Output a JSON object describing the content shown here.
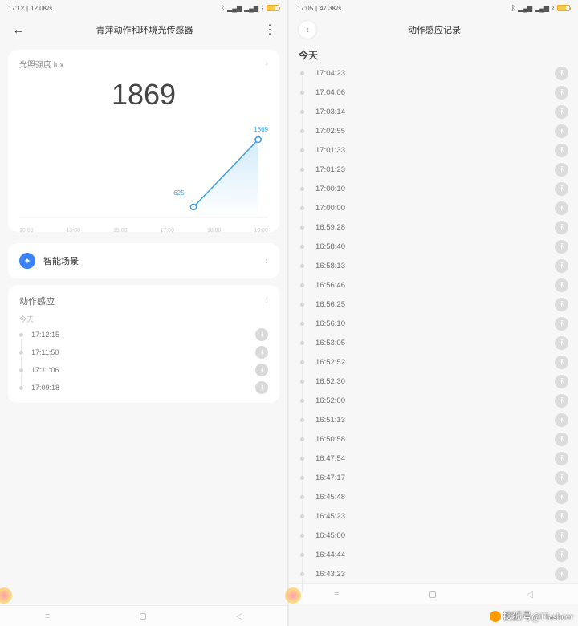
{
  "left": {
    "status": {
      "time": "17:12",
      "speed": "12.0K/s"
    },
    "title": "青萍动作和环境光传感器",
    "lux": {
      "label": "光照强度 lux",
      "value": "1869"
    },
    "chart_data": {
      "type": "line",
      "x": [
        "10:00",
        "13:00",
        "15:00",
        "17:00",
        "18:00",
        "19:00"
      ],
      "points": [
        {
          "label": "625",
          "x": 0.7,
          "y": 0.78
        },
        {
          "label": "1869",
          "x": 0.96,
          "y": 0.18
        }
      ],
      "ylim": [
        0,
        2000
      ]
    },
    "scene": "智能场景",
    "motion": {
      "label": "动作感应",
      "today": "今天",
      "rows": [
        "17:12:15",
        "17:11:50",
        "17:11:06",
        "17:09:18"
      ]
    }
  },
  "right": {
    "status": {
      "time": "17:05",
      "speed": "47.3K/s"
    },
    "title": "动作感应记录",
    "today": "今天",
    "rows": [
      "17:04:23",
      "17:04:06",
      "17:03:14",
      "17:02:55",
      "17:01:33",
      "17:01:23",
      "17:00:10",
      "17:00:00",
      "16:59:28",
      "16:58:40",
      "16:58:13",
      "16:56:46",
      "16:56:25",
      "16:56:10",
      "16:53:05",
      "16:52:52",
      "16:52:30",
      "16:52:00",
      "16:51:13",
      "16:50:58",
      "16:47:54",
      "16:47:17",
      "16:45:48",
      "16:45:23",
      "16:45:00",
      "16:44:44",
      "16:43:23"
    ]
  },
  "watermark": "搜狐号@Flashcer"
}
